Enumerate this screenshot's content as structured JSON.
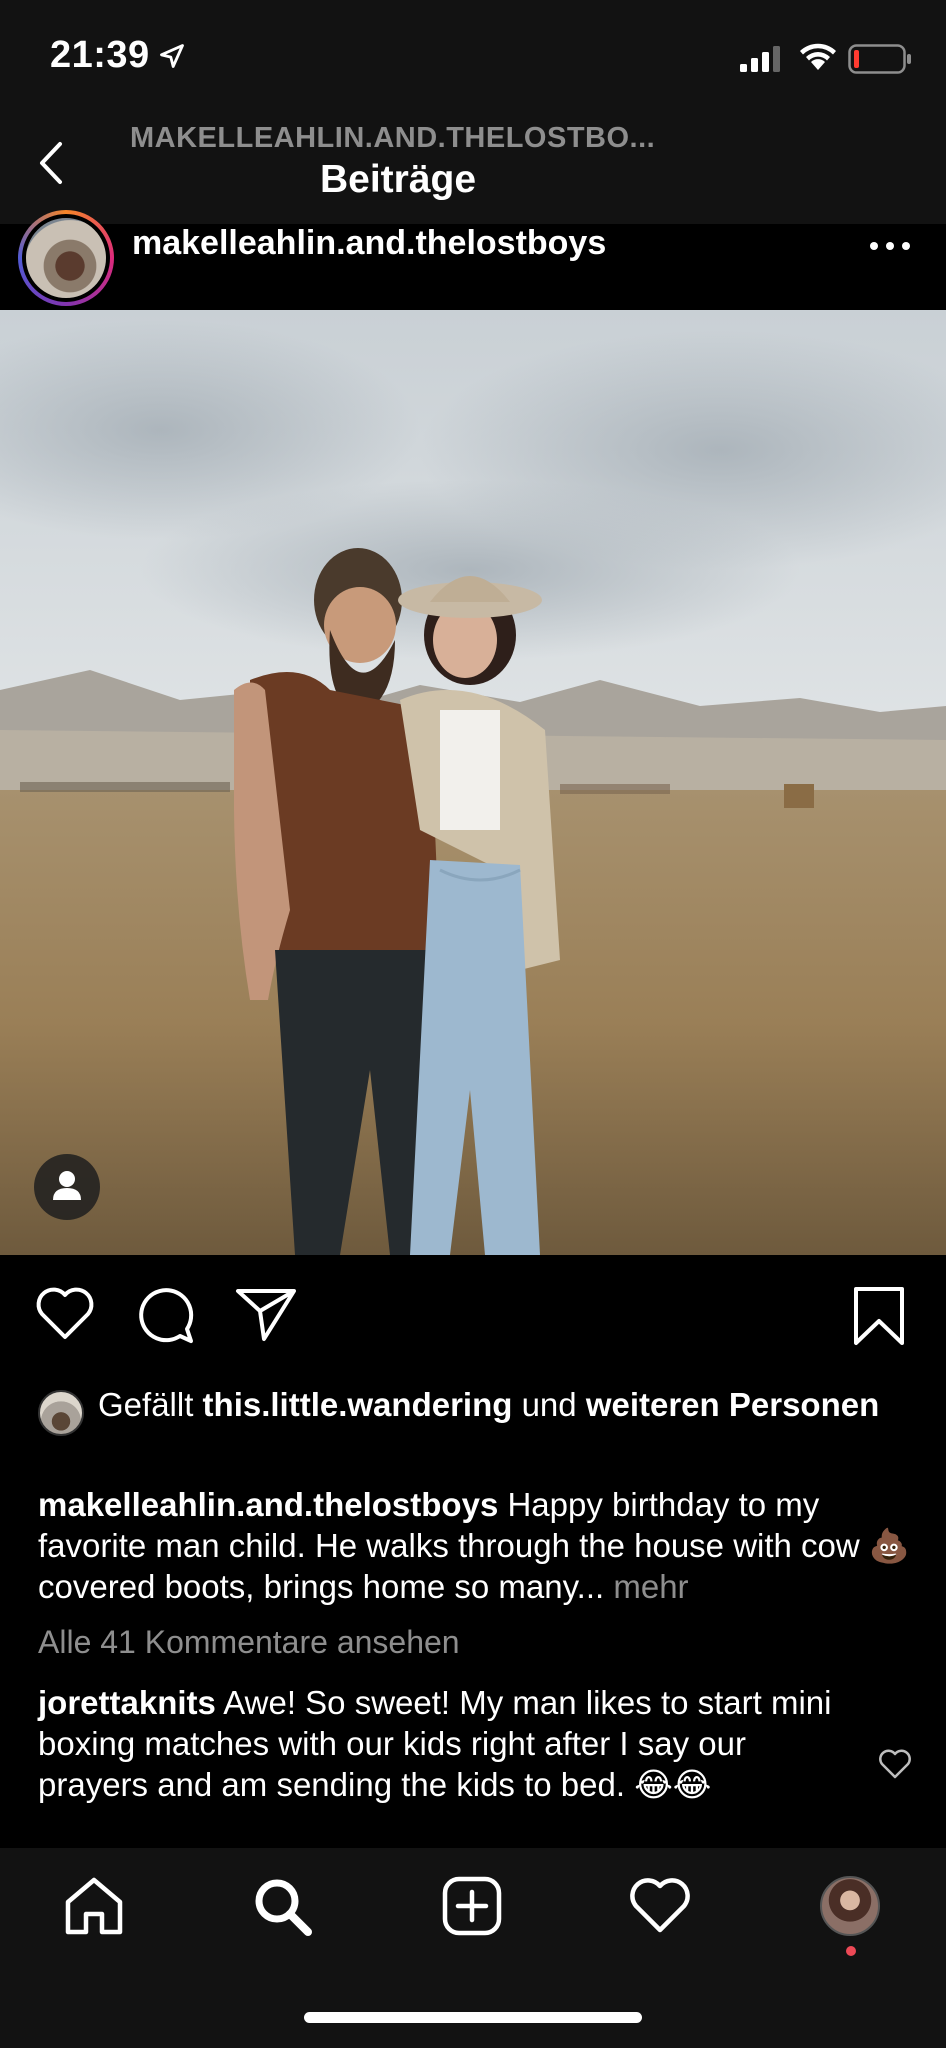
{
  "status_bar": {
    "time": "21:39"
  },
  "header": {
    "subtitle": "MAKELLEAHLIN.AND.THELOSTBO...",
    "title": "Beiträge"
  },
  "post": {
    "username": "makelleahlin.and.thelostboys"
  },
  "likes": {
    "prefix": "Gefällt ",
    "liker": "this.little.wandering",
    "middle": " und ",
    "others": "weiteren Personen"
  },
  "caption": {
    "username": "makelleahlin.and.thelostboys",
    "text_before_emoji": " Happy birthday to my favorite man child. He walks through the house with cow ",
    "emoji": "💩",
    "text_after_emoji": " covered boots, brings home so many...",
    "more": " mehr"
  },
  "comments": {
    "view_all": "Alle 41 Kommentare ansehen",
    "items": [
      {
        "username": "jorettaknits",
        "text": " Awe!  So sweet!  My man likes to start mini boxing matches with our kids right after I say our prayers and am sending the kids to bed. 😂😂"
      }
    ]
  },
  "colors": {
    "background": "#000000",
    "bar": "#121212",
    "muted_text": "#8e8e8e",
    "notification": "#ed4956"
  },
  "icons": {
    "back": "chevron-left-icon",
    "more": "ellipsis-icon",
    "like": "heart-icon",
    "comment": "speech-bubble-icon",
    "share": "paper-plane-icon",
    "save": "bookmark-icon",
    "tag": "person-icon",
    "tabs": [
      "home-icon",
      "search-icon",
      "plus-square-icon",
      "heart-icon",
      "profile-avatar"
    ]
  }
}
